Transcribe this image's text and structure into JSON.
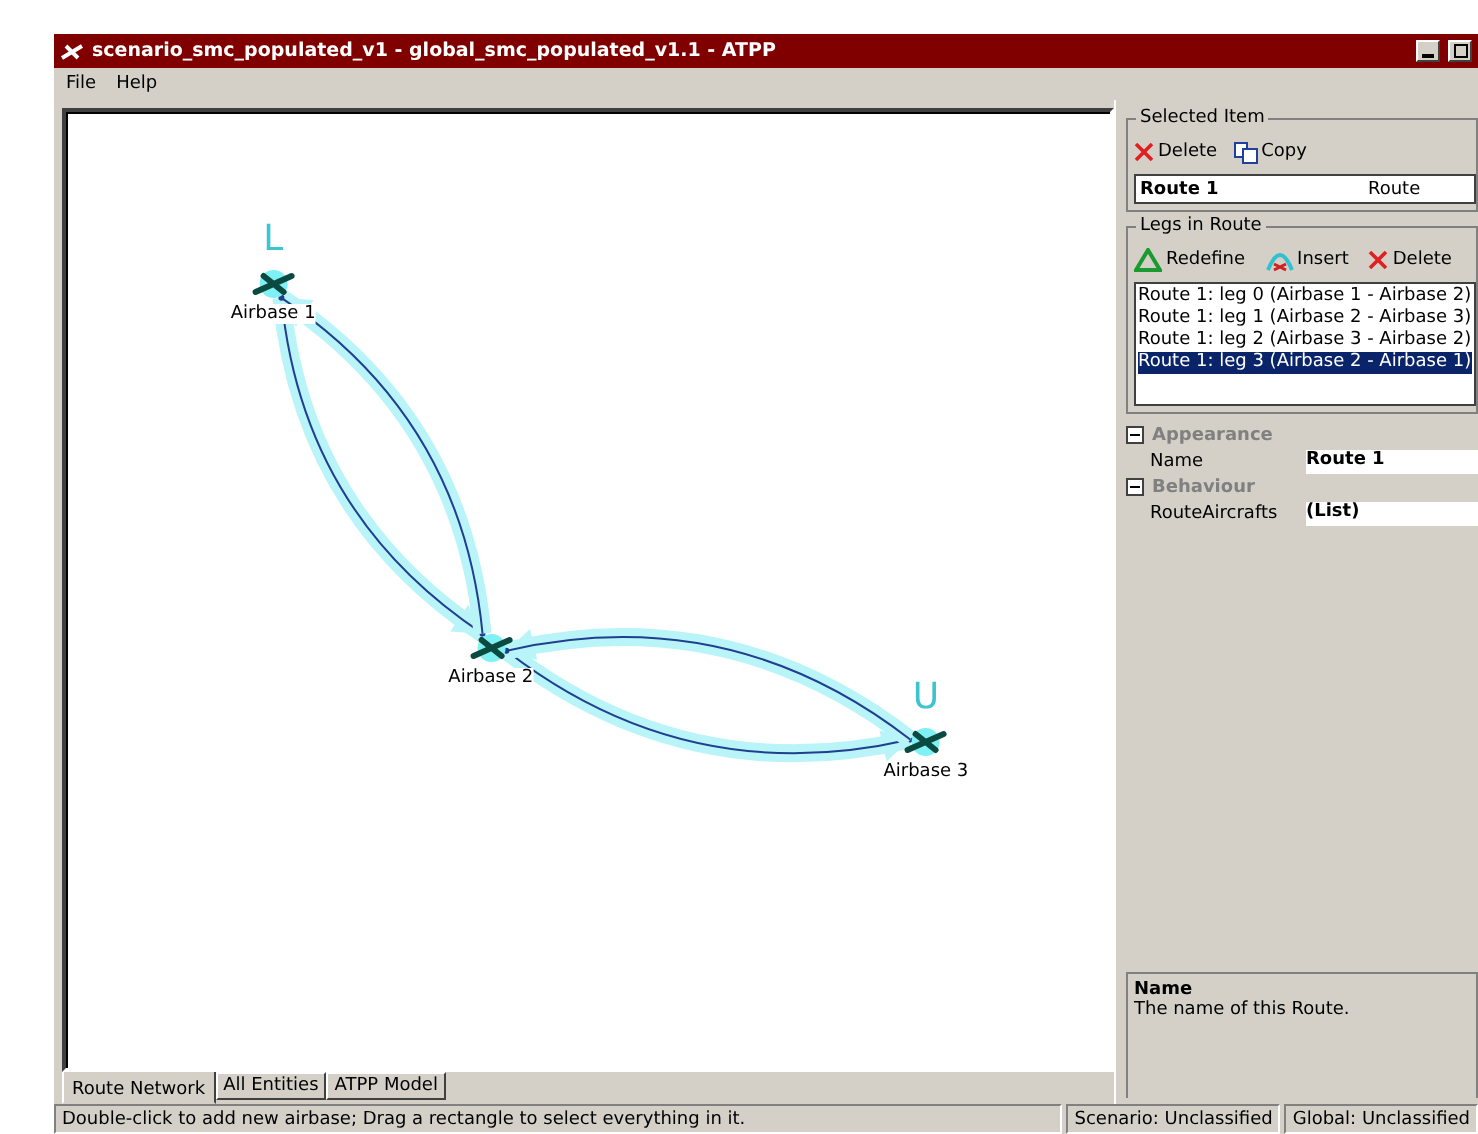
{
  "window": {
    "title": "scenario_smc_populated_v1 - global_smc_populated_v1.1 - ATPP"
  },
  "menu": [
    "File",
    "Help"
  ],
  "network": {
    "highlighted": true,
    "nodes": [
      {
        "label": "Airbase 1",
        "marker": "L"
      },
      {
        "label": "Airbase 2"
      },
      {
        "label": "Airbase 3",
        "marker": "U"
      }
    ]
  },
  "tabs": [
    {
      "label": "Route Network",
      "selected": true
    },
    {
      "label": "All Entities",
      "selected": false
    },
    {
      "label": "ATPP Model",
      "selected": false
    }
  ],
  "selected_item": {
    "title": "Selected Item",
    "actions": [
      {
        "kind": "delete",
        "label": "Delete"
      },
      {
        "kind": "copy",
        "label": "Copy"
      }
    ],
    "name": "Route 1",
    "type": "Route"
  },
  "legs_in_route": {
    "title": "Legs in Route",
    "actions": [
      {
        "kind": "redefine",
        "label": "Redefine"
      },
      {
        "kind": "insert",
        "label": "Insert"
      },
      {
        "kind": "delete",
        "label": "Delete"
      }
    ],
    "items": [
      {
        "label": "Route 1: leg 0 (Airbase 1 - Airbase 2)",
        "selected": false
      },
      {
        "label": "Route 1: leg 1 (Airbase 2 - Airbase 3)",
        "selected": false
      },
      {
        "label": "Route 1: leg 2 (Airbase 3 - Airbase 2)",
        "selected": false
      },
      {
        "label": "Route 1: leg 3 (Airbase 2 - Airbase 1)",
        "selected": true
      }
    ]
  },
  "properties": [
    {
      "category": "Appearance",
      "expanded": true,
      "rows": [
        {
          "name": "Name",
          "value": "Route 1"
        }
      ]
    },
    {
      "category": "Behaviour",
      "expanded": true,
      "rows": [
        {
          "name": "RouteAircrafts",
          "value": "(List)"
        }
      ]
    }
  ],
  "description": {
    "title": "Name",
    "text": "The name of this Route."
  },
  "status_bar": {
    "message": "Double-click to add new airbase; Drag a rectangle to select everything in it.",
    "scenario": "Scenario: Unclassified",
    "global": "Global: Unclassified"
  }
}
